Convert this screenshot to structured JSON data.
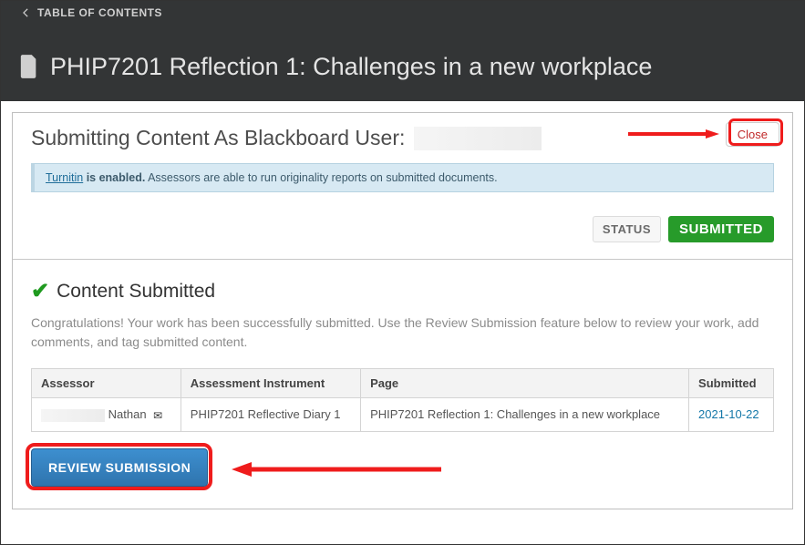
{
  "header": {
    "toc_label": "TABLE OF CONTENTS",
    "page_title": "PHIP7201 Reflection 1: Challenges in a new workplace"
  },
  "panel": {
    "submit_as_prefix": "Submitting Content As Blackboard User:",
    "close_label": "Close",
    "turnitin": {
      "link": "Turnitin",
      "suffix_bold": " is enabled.",
      "rest": " Assessors are able to run originality reports on submitted documents."
    },
    "status_label": "STATUS",
    "status_value": "SUBMITTED",
    "submitted_heading": "Content Submitted",
    "congrats": "Congratulations! Your work has been successfully submitted. Use the Review Submission feature below to review your work, add comments, and tag submitted content.",
    "table": {
      "headers": {
        "assessor": "Assessor",
        "instrument": "Assessment Instrument",
        "page": "Page",
        "submitted": "Submitted"
      },
      "row": {
        "assessor_name": "Nathan",
        "instrument": "PHIP7201 Reflective Diary 1",
        "page": "PHIP7201 Reflection 1: Challenges in a new workplace",
        "date": "2021-10-22"
      }
    },
    "review_label": "REVIEW SUBMISSION"
  }
}
